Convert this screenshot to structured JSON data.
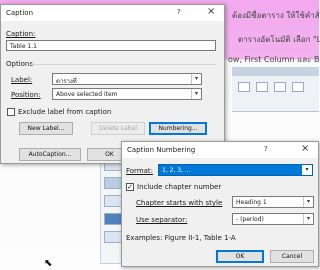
{
  "document": {
    "line1": "ต้องมีชื่อตาราง ให้ใช้คำสั่ง",
    "line2": "ตารางอัตโนมัติ เลือก \"Lis",
    "line3": "ow, First Column และ Banc"
  },
  "caption_dialog": {
    "title": "Caption",
    "help": "?",
    "close": "×",
    "caption_label": "Caption:",
    "caption_value": "Table 1.1",
    "options_label": "Options",
    "label_label": "Label:",
    "label_value": "ตารางที่",
    "position_label": "Position:",
    "position_value": "Above selected item",
    "exclude_label": "Exclude label from caption",
    "exclude_checked": false,
    "new_label_button": "New Label...",
    "delete_label_button": "Delete Label",
    "numbering_button": "Numbering...",
    "autocaption_button": "AutoCaption...",
    "ok_button": "OK"
  },
  "numbering_dialog": {
    "title": "Caption Numbering",
    "help": "?",
    "close": "×",
    "format_label": "Format:",
    "format_value": "1, 2, 3, ...",
    "include_chapter_label": "Include chapter number",
    "include_chapter_checked": true,
    "chapter_style_label": "Chapter starts with style",
    "chapter_style_value": "Heading 1",
    "separator_label": "Use separator:",
    "separator_value": "-    (period)",
    "examples_text": "Examples:  Figure II-1, Table 1-A",
    "ok_button": "OK",
    "cancel_button": "Cancel"
  },
  "colors": {
    "accent": "#0078d7",
    "doc_header_pink": "#f2a9ee",
    "dialog_bg": "#f0f0f0"
  }
}
